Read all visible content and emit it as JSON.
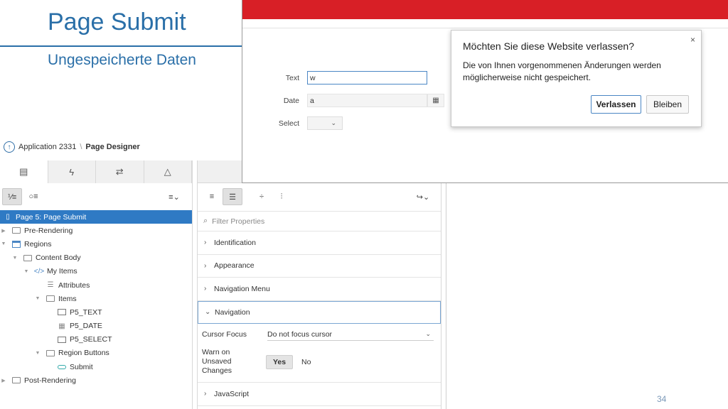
{
  "slide": {
    "title": "Page Submit",
    "subtitle": "Ungespeicherte Daten",
    "page_number": "34"
  },
  "breadcrumb": {
    "app": "Application 2331",
    "separator": "\\",
    "current": "Page Designer"
  },
  "tree": {
    "items": [
      {
        "label": "Page 5: Page Submit"
      },
      {
        "label": "Pre-Rendering"
      },
      {
        "label": "Regions"
      },
      {
        "label": "Content Body"
      },
      {
        "label": "My Items"
      },
      {
        "label": "Attributes"
      },
      {
        "label": "Items"
      },
      {
        "label": "P5_TEXT"
      },
      {
        "label": "P5_DATE"
      },
      {
        "label": "P5_SELECT"
      },
      {
        "label": "Region Buttons"
      },
      {
        "label": "Submit"
      },
      {
        "label": "Post-Rendering"
      }
    ]
  },
  "properties": {
    "filter_placeholder": "Filter Properties",
    "groups": {
      "identification": "Identification",
      "appearance": "Appearance",
      "navigation_menu": "Navigation Menu",
      "navigation": "Navigation",
      "javascript": "JavaScript"
    },
    "cursor_focus_label": "Cursor Focus",
    "cursor_focus_value": "Do not focus cursor",
    "warn_label_line1": "Warn on",
    "warn_label_line2": "Unsaved",
    "warn_label_line3": "Changes",
    "yes": "Yes",
    "no": "No"
  },
  "form": {
    "text_label": "Text",
    "text_value": "w",
    "date_label": "Date",
    "date_value": "a",
    "select_label": "Select"
  },
  "dialog": {
    "title": "Möchten Sie diese Website verlassen?",
    "message": "Die von Ihnen vorgenommenen Änderungen werden möglicherweise nicht gespeichert.",
    "leave_label": "Verlassen",
    "stay_label": "Bleiben",
    "close_glyph": "×"
  },
  "colors": {
    "accent_blue": "#2a6fa8",
    "selection_blue": "#2f7ac4",
    "browser_red": "#d81f26"
  }
}
